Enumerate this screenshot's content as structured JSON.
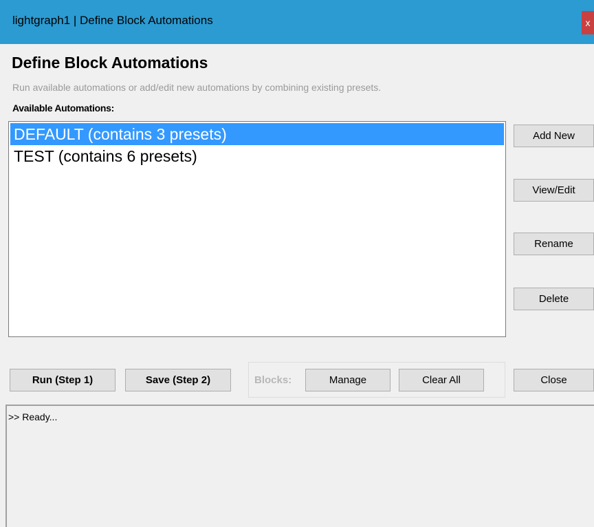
{
  "window": {
    "title": "lightgraph1 | Define Block Automations",
    "close_glyph": "x"
  },
  "header": {
    "heading": "Define Block Automations",
    "subtitle": "Run available automations or add/edit new automations by combining existing presets."
  },
  "automations": {
    "label": "Available Automations:",
    "items": [
      {
        "label": "DEFAULT (contains 3 presets)",
        "selected": true
      },
      {
        "label": "TEST (contains 6 presets)",
        "selected": false
      }
    ]
  },
  "side_buttons": {
    "add_new": "Add New",
    "view_edit": "View/Edit",
    "rename": "Rename",
    "delete": "Delete"
  },
  "bottom_buttons": {
    "run": "Run (Step 1)",
    "save": "Save (Step 2)",
    "blocks_label": "Blocks:",
    "manage": "Manage",
    "clear_all": "Clear All",
    "close": "Close"
  },
  "log": {
    "text": ">> Ready..."
  },
  "colors": {
    "titlebar": "#2b9bd2",
    "selection": "#3399ff",
    "close_button": "#c94040"
  }
}
